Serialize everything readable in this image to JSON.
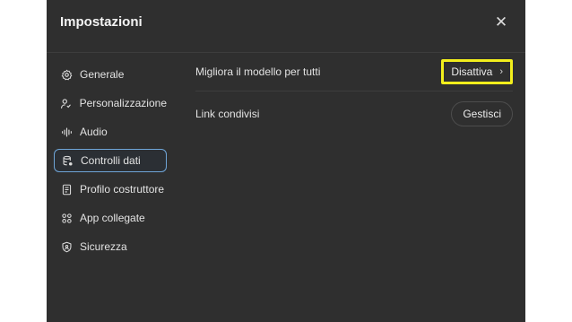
{
  "dialog": {
    "title": "Impostazioni",
    "close_icon": "close-icon",
    "close_glyph": "✕"
  },
  "sidebar": {
    "items": [
      {
        "label": "Generale",
        "icon": "gear-icon",
        "active": false
      },
      {
        "label": "Personalizzazione",
        "icon": "person-icon",
        "active": false
      },
      {
        "label": "Audio",
        "icon": "audio-wave-icon",
        "active": false
      },
      {
        "label": "Controlli dati",
        "icon": "database-icon",
        "active": true
      },
      {
        "label": "Profilo costruttore",
        "icon": "id-card-icon",
        "active": false
      },
      {
        "label": "App collegate",
        "icon": "apps-grid-icon",
        "active": false
      },
      {
        "label": "Sicurezza",
        "icon": "shield-icon",
        "active": false
      }
    ]
  },
  "content": {
    "rows": [
      {
        "label": "Migliora il modello per tutti",
        "action": "Disattiva",
        "action_icon": "chevron-right-icon",
        "chevron": "›"
      },
      {
        "label": "Link condivisi",
        "action": "Gestisci"
      }
    ]
  },
  "colors": {
    "dialog_bg": "#2f2f2f",
    "highlight": "#f2ee1c",
    "active_border": "#6fa5d8"
  }
}
